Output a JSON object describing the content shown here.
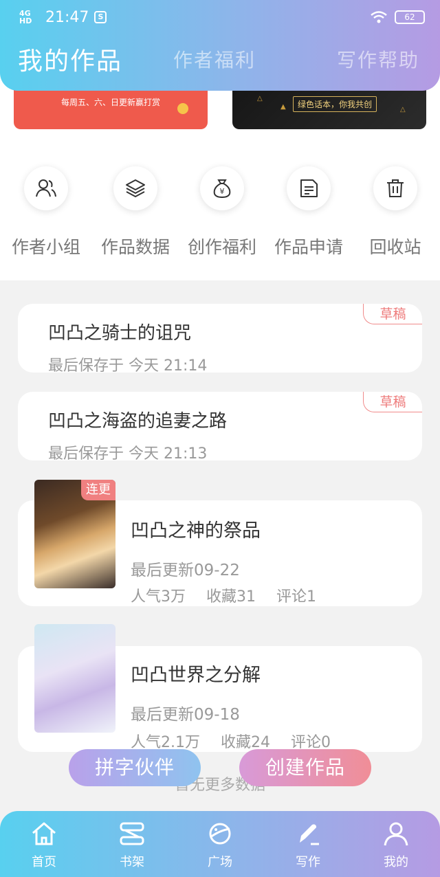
{
  "status_bar": {
    "network": "4G HD",
    "time": "21:47",
    "battery": "62"
  },
  "header": {
    "tabs": [
      {
        "label": "我的作品",
        "active": true
      },
      {
        "label": "作者福利",
        "active": false
      },
      {
        "label": "写作帮助",
        "active": false
      }
    ]
  },
  "banners": {
    "left_text": "每周五、六、日更新赢打赏",
    "right_text": "绿色话本，你我共创"
  },
  "quick_actions": [
    {
      "label": "作者小组",
      "icon": "group-icon"
    },
    {
      "label": "作品数据",
      "icon": "layers-icon"
    },
    {
      "label": "创作福利",
      "icon": "money-bag-icon"
    },
    {
      "label": "作品申请",
      "icon": "document-icon"
    },
    {
      "label": "回收站",
      "icon": "trash-icon"
    }
  ],
  "drafts": [
    {
      "title": "凹凸之骑士的诅咒",
      "saved": "最后保存于 今天 21:14",
      "badge": "草稿"
    },
    {
      "title": "凹凸之海盗的追妻之路",
      "saved": "最后保存于 今天 21:13",
      "badge": "草稿"
    }
  ],
  "works": [
    {
      "title": "凹凸之神的祭品",
      "updated": "最后更新09-22",
      "popularity": "人气3万",
      "favorites": "收藏31",
      "comments": "评论1",
      "badge": "连更"
    },
    {
      "title": "凹凸世界之分解",
      "updated": "最后更新09-18",
      "popularity": "人气2.1万",
      "favorites": "收藏24",
      "comments": "评论0"
    }
  ],
  "no_more": "暂无更多数据",
  "fab": {
    "left": "拼字伙伴",
    "right": "创建作品"
  },
  "bottom_nav": [
    {
      "label": "首页",
      "icon": "home-icon"
    },
    {
      "label": "书架",
      "icon": "bookshelf-icon"
    },
    {
      "label": "广场",
      "icon": "planet-icon"
    },
    {
      "label": "写作",
      "icon": "pen-icon",
      "active": true
    },
    {
      "label": "我的",
      "icon": "profile-icon"
    }
  ]
}
